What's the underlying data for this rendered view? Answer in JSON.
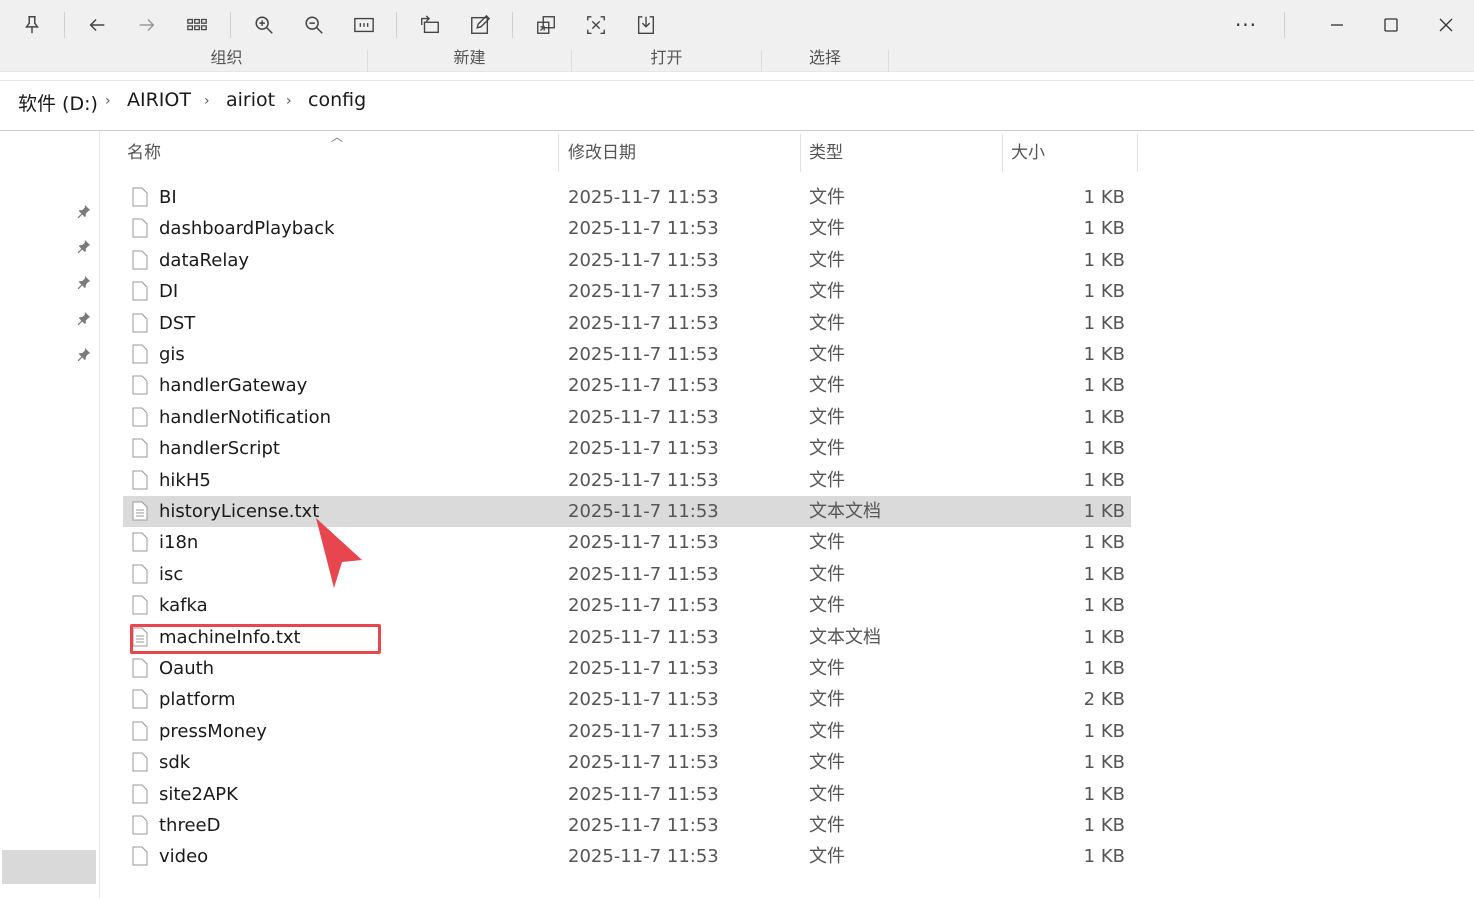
{
  "toolbar": {
    "icons": [
      "pin-icon",
      "back-icon",
      "forward-icon",
      "grid-icon",
      "zoom-in-icon",
      "zoom-out-icon",
      "fit-icon",
      "rotate-icon",
      "edit-icon",
      "copy-icon",
      "crop-icon",
      "save-icon"
    ],
    "more_label": "···"
  },
  "ribbon": {
    "groups": [
      "组织",
      "新建",
      "打开",
      "选择"
    ]
  },
  "breadcrumb": {
    "items": [
      "软件 (D:)",
      "AIRIOT",
      "airiot",
      "config"
    ],
    "separator": "›"
  },
  "columns": {
    "name": "名称",
    "date": "修改日期",
    "type": "类型",
    "size": "大小"
  },
  "files": [
    {
      "name": "BI",
      "date": "2025-11-7 11:53",
      "type": "文件",
      "size": "1 KB"
    },
    {
      "name": "dashboardPlayback",
      "date": "2025-11-7 11:53",
      "type": "文件",
      "size": "1 KB"
    },
    {
      "name": "dataRelay",
      "date": "2025-11-7 11:53",
      "type": "文件",
      "size": "1 KB"
    },
    {
      "name": "DI",
      "date": "2025-11-7 11:53",
      "type": "文件",
      "size": "1 KB"
    },
    {
      "name": "DST",
      "date": "2025-11-7 11:53",
      "type": "文件",
      "size": "1 KB"
    },
    {
      "name": "gis",
      "date": "2025-11-7 11:53",
      "type": "文件",
      "size": "1 KB"
    },
    {
      "name": "handlerGateway",
      "date": "2025-11-7 11:53",
      "type": "文件",
      "size": "1 KB"
    },
    {
      "name": "handlerNotification",
      "date": "2025-11-7 11:53",
      "type": "文件",
      "size": "1 KB"
    },
    {
      "name": "handlerScript",
      "date": "2025-11-7 11:53",
      "type": "文件",
      "size": "1 KB"
    },
    {
      "name": "hikH5",
      "date": "2025-11-7 11:53",
      "type": "文件",
      "size": "1 KB"
    },
    {
      "name": "historyLicense.txt",
      "date": "2025-11-7 11:53",
      "type": "文本文档",
      "size": "1 KB",
      "selected": true
    },
    {
      "name": "i18n",
      "date": "2025-11-7 11:53",
      "type": "文件",
      "size": "1 KB"
    },
    {
      "name": "isc",
      "date": "2025-11-7 11:53",
      "type": "文件",
      "size": "1 KB"
    },
    {
      "name": "kafka",
      "date": "2025-11-7 11:53",
      "type": "文件",
      "size": "1 KB"
    },
    {
      "name": "machineInfo.txt",
      "date": "2025-11-7 11:53",
      "type": "文本文档",
      "size": "1 KB",
      "highlighted": true
    },
    {
      "name": "Oauth",
      "date": "2025-11-7 11:53",
      "type": "文件",
      "size": "1 KB"
    },
    {
      "name": "platform",
      "date": "2025-11-7 11:53",
      "type": "文件",
      "size": "2 KB"
    },
    {
      "name": "pressMoney",
      "date": "2025-11-7 11:53",
      "type": "文件",
      "size": "1 KB"
    },
    {
      "name": "sdk",
      "date": "2025-11-7 11:53",
      "type": "文件",
      "size": "1 KB"
    },
    {
      "name": "site2APK",
      "date": "2025-11-7 11:53",
      "type": "文件",
      "size": "1 KB"
    },
    {
      "name": "threeD",
      "date": "2025-11-7 11:53",
      "type": "文件",
      "size": "1 KB"
    },
    {
      "name": "video",
      "date": "2025-11-7 11:53",
      "type": "文件",
      "size": "1 KB"
    }
  ],
  "colors": {
    "selection": "#dadada",
    "annotation": "#e8464e"
  }
}
